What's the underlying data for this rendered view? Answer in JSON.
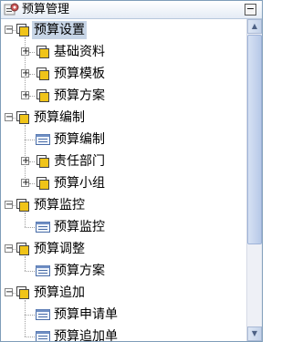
{
  "panel": {
    "title": "预算管理",
    "collapse_symbol": "−"
  },
  "tree": [
    {
      "label": "预算设置",
      "type": "folder",
      "level": 0,
      "expanded": true,
      "selected": true,
      "children": [
        {
          "label": "基础资料",
          "type": "folder",
          "expanded": false
        },
        {
          "label": "预算模板",
          "type": "folder",
          "expanded": false
        },
        {
          "label": "预算方案",
          "type": "folder",
          "expanded": false
        }
      ]
    },
    {
      "label": "预算编制",
      "type": "folder",
      "level": 0,
      "expanded": true,
      "children": [
        {
          "label": "预算编制",
          "type": "page"
        },
        {
          "label": "责任部门",
          "type": "folder",
          "expanded": false
        },
        {
          "label": "预算小组",
          "type": "folder",
          "expanded": false
        }
      ]
    },
    {
      "label": "预算监控",
      "type": "folder",
      "level": 0,
      "expanded": true,
      "children": [
        {
          "label": "预算监控",
          "type": "page"
        }
      ]
    },
    {
      "label": "预算调整",
      "type": "folder",
      "level": 0,
      "expanded": true,
      "children": [
        {
          "label": "预算方案",
          "type": "page"
        }
      ]
    },
    {
      "label": "预算追加",
      "type": "folder",
      "level": 0,
      "expanded": true,
      "children": [
        {
          "label": "预算申请单",
          "type": "page"
        },
        {
          "label": "预算追加单",
          "type": "page"
        }
      ]
    }
  ],
  "expander": {
    "expanded": "−",
    "collapsed": "+"
  },
  "scrollbar": {
    "up_arrow": "▲",
    "down_arrow": "▼",
    "position": 0.0,
    "visible_fraction": 0.72
  },
  "colors": {
    "selection": "#c7d5e6",
    "border": "#7f9db9",
    "folder": "#f0c419"
  }
}
